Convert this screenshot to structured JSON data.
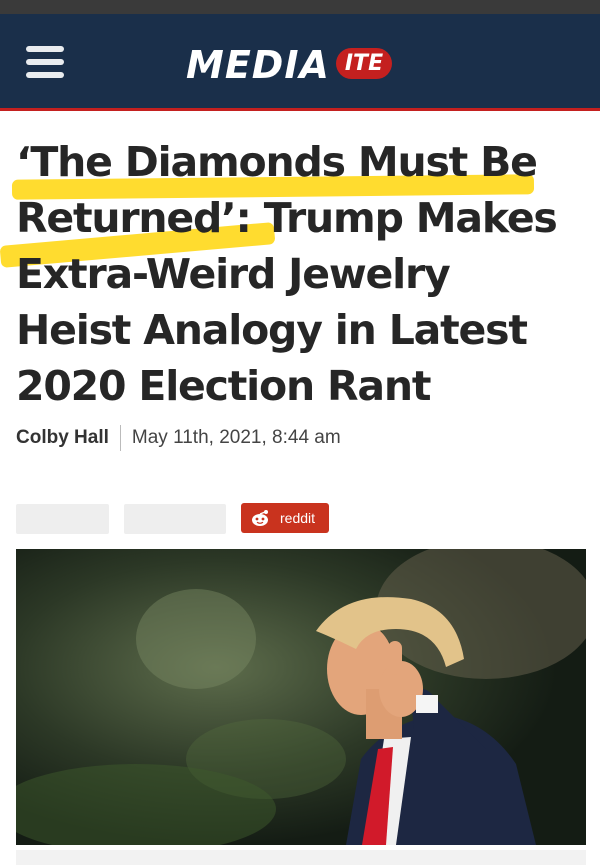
{
  "header": {
    "logo_main": "MEDIA",
    "logo_badge": "ITE",
    "colors": {
      "bar": "#1a2f4a",
      "accent": "#c4201f"
    }
  },
  "article": {
    "headline_line1": "‘The Diamonds Must Be",
    "headline_line2": "Returned’: Trump Makes",
    "headline_line3": "Extra-Weird Jewelry",
    "headline_line4": "Heist Analogy in Latest",
    "headline_line5": "2020 Election Rant",
    "author": "Colby Hall",
    "date": "May 11th, 2021, 8:44 am"
  },
  "share": {
    "reddit_label": "reddit",
    "reddit_color": "#c9331e"
  },
  "image": {
    "icon": "photo-of-trump-thumbs-up"
  }
}
